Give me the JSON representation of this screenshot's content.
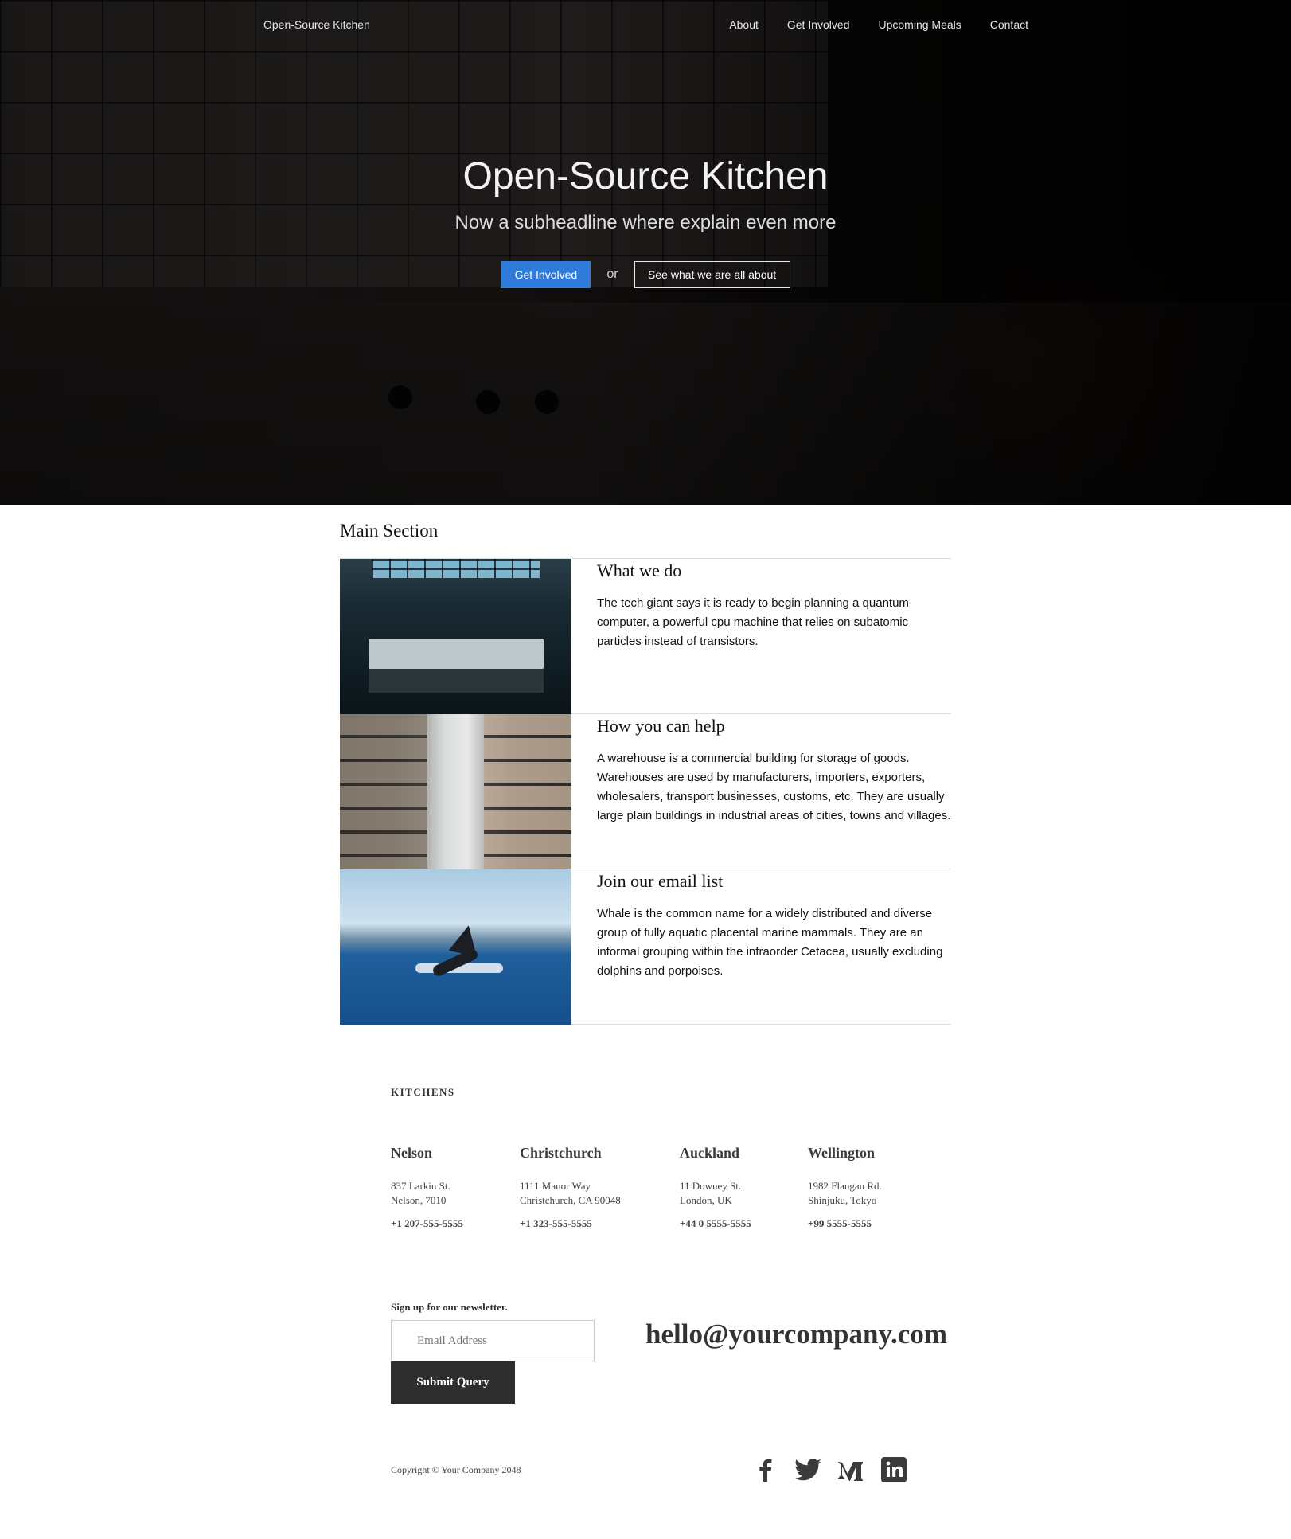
{
  "nav": {
    "brand": "Open-Source Kitchen",
    "links": [
      "About",
      "Get Involved",
      "Upcoming Meals",
      "Contact"
    ]
  },
  "hero": {
    "title": "Open-Source Kitchen",
    "subtitle": "Now a subheadline where explain even more",
    "primary_cta": "Get Involved",
    "or_text": "or",
    "secondary_cta": "See what we are all about"
  },
  "main": {
    "title": "Main Section",
    "features": [
      {
        "heading": "What we do",
        "body": "The tech giant says it is ready to begin planning a quantum computer, a powerful cpu machine that relies on subatomic particles instead of transistors."
      },
      {
        "heading": "How you can help",
        "body": "A warehouse is a commercial building for storage of goods. Warehouses are used by manufacturers, importers, exporters, wholesalers, transport businesses, customs, etc. They are usually large plain buildings in industrial areas of cities, towns and villages."
      },
      {
        "heading": "Join our email list",
        "body": "Whale is the common name for a widely distributed and diverse group of fully aquatic placental marine mammals. They are an informal grouping within the infraorder Cetacea, usually excluding dolphins and porpoises."
      }
    ]
  },
  "kitchens": {
    "label": "KITCHENS",
    "locations": [
      {
        "city": "Nelson",
        "line1": "837 Larkin St.",
        "line2": "Nelson, 7010",
        "phone": "+1 207-555-5555"
      },
      {
        "city": "Christchurch",
        "line1": "1111 Manor Way",
        "line2": "Christchurch, CA 90048",
        "phone": "+1 323-555-5555"
      },
      {
        "city": "Auckland",
        "line1": "11 Downey St.",
        "line2": "London, UK",
        "phone": "+44 0 5555-5555"
      },
      {
        "city": "Wellington",
        "line1": "1982 Flangan Rd.",
        "line2": "Shinjuku, Tokyo",
        "phone": "+99 5555-5555"
      }
    ]
  },
  "newsletter": {
    "label": "Sign up for our newsletter.",
    "placeholder": "Email Address",
    "submit": "Submit Query",
    "email": "hello@yourcompany.com"
  },
  "footer": {
    "copyright": "Copyright © Your Company 2048",
    "social_icons": [
      "facebook-icon",
      "twitter-icon",
      "medium-icon",
      "linkedin-icon"
    ]
  },
  "colors": {
    "accent": "#2f7bd9",
    "dark_button": "#2d2d2d"
  }
}
